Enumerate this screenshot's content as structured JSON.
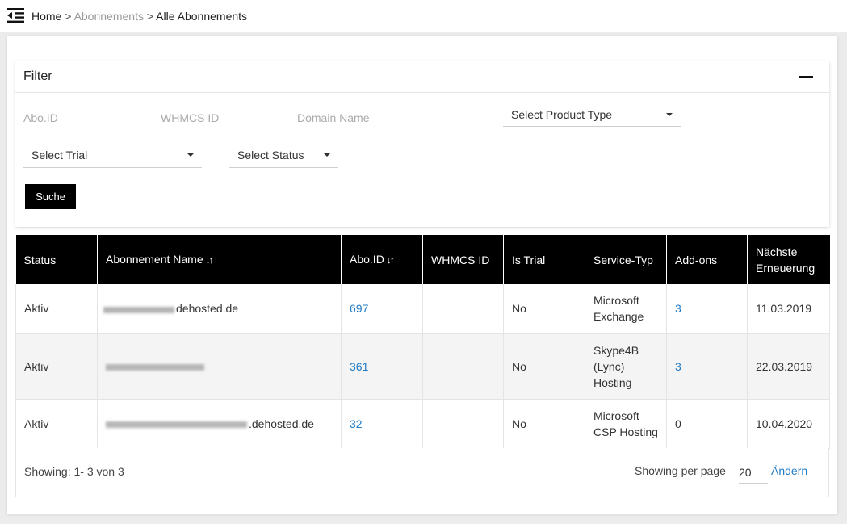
{
  "breadcrumb": {
    "home": "Home",
    "sep": ">",
    "subscriptions": "Abonnements",
    "current": "Alle Abonnements"
  },
  "filter": {
    "title": "Filter",
    "abo_id_placeholder": "Abo.ID",
    "whmcs_id_placeholder": "WHMCS ID",
    "domain_placeholder": "Domain Name",
    "product_type": "Select Product Type",
    "trial": "Select Trial",
    "status": "Select Status",
    "search_label": "Suche"
  },
  "table": {
    "headers": {
      "status": "Status",
      "name": "Abonnement Name",
      "abo_id": "Abo.ID",
      "whmcs_id": "WHMCS ID",
      "is_trial": "Is Trial",
      "service": "Service-Typ",
      "addons": "Add-ons",
      "next_renewal": "Nächste Erneuerung"
    },
    "rows": [
      {
        "status": "Aktiv",
        "name_suffix": "dehosted.de",
        "abo_id": "697",
        "whmcs_id": "",
        "is_trial": "No",
        "service": "Microsoft Exchange",
        "addons": "3",
        "next_renewal": "11.03.2019"
      },
      {
        "status": "Aktiv",
        "name_suffix": "",
        "abo_id": "361",
        "whmcs_id": "",
        "is_trial": "No",
        "service": "Skype4B (Lync) Hosting",
        "addons": "3",
        "next_renewal": "22.03.2019"
      },
      {
        "status": "Aktiv",
        "name_suffix": ".dehosted.de",
        "abo_id": "32",
        "whmcs_id": "",
        "is_trial": "No",
        "service": "Microsoft CSP Hosting",
        "addons": "0",
        "next_renewal": "10.04.2020"
      }
    ]
  },
  "footer": {
    "showing": "Showing: 1- 3 von 3",
    "per_page_label": "Showing per page",
    "per_page_value": "20",
    "change_label": "Ändern"
  },
  "icons": {
    "menu": "menu-collapse-icon",
    "sort": "sort-arrows-icon",
    "collapse": "minus-icon",
    "caret": "caret-down-icon"
  },
  "colors": {
    "link": "#1f7ac7",
    "header_bg": "#000000",
    "alt_row": "#f4f4f4"
  }
}
